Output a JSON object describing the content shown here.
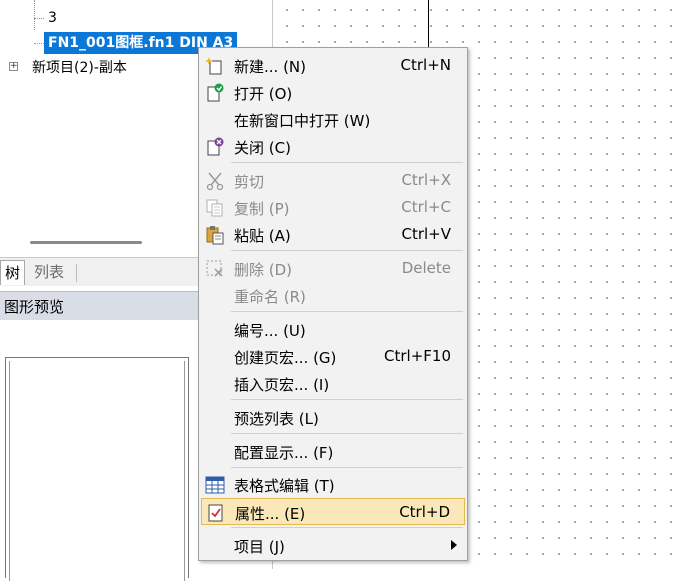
{
  "tree": {
    "items": [
      {
        "label": "3"
      },
      {
        "label": "FN1_001图框.fn1 DIN A3"
      },
      {
        "label": "新项目(2)-副本"
      }
    ],
    "expander_symbol": "+"
  },
  "tabs": [
    {
      "label": "树"
    },
    {
      "label": "列表"
    }
  ],
  "preview": {
    "title": "图形预览"
  },
  "colors": {
    "selection": "#0b78d7",
    "highlight": "#fbe8b8",
    "highlight_border": "#e5b850"
  },
  "context_menu": {
    "items": [
      {
        "label": "新建... (N)",
        "shortcut": "Ctrl+N",
        "icon": "new-sparkle-icon",
        "disabled": false
      },
      {
        "label": "打开 (O)",
        "shortcut": "",
        "icon": "open-page-icon",
        "disabled": false
      },
      {
        "label": "在新窗口中打开 (W)",
        "shortcut": "",
        "icon": "",
        "disabled": false
      },
      {
        "label": "关闭 (C)",
        "shortcut": "",
        "icon": "close-page-icon",
        "disabled": false
      },
      {
        "label": "剪切",
        "shortcut": "Ctrl+X",
        "icon": "scissors-icon",
        "disabled": true
      },
      {
        "label": "复制 (P)",
        "shortcut": "Ctrl+C",
        "icon": "copy-icon",
        "disabled": true
      },
      {
        "label": "粘贴 (A)",
        "shortcut": "Ctrl+V",
        "icon": "paste-clipboard-icon",
        "disabled": false
      },
      {
        "label": "删除 (D)",
        "shortcut": "Delete",
        "icon": "delete-icon",
        "disabled": true
      },
      {
        "label": "重命名 (R)",
        "shortcut": "",
        "icon": "",
        "disabled": true
      },
      {
        "label": "编号... (U)",
        "shortcut": "",
        "icon": "",
        "disabled": false
      },
      {
        "label": "创建页宏... (G)",
        "shortcut": "Ctrl+F10",
        "icon": "",
        "disabled": false
      },
      {
        "label": "插入页宏... (I)",
        "shortcut": "",
        "icon": "",
        "disabled": false
      },
      {
        "label": "预选列表 (L)",
        "shortcut": "",
        "icon": "",
        "disabled": false
      },
      {
        "label": "配置显示... (F)",
        "shortcut": "",
        "icon": "",
        "disabled": false
      },
      {
        "label": "表格式编辑 (T)",
        "shortcut": "",
        "icon": "table-grid-icon",
        "disabled": false
      },
      {
        "label": "属性... (E)",
        "shortcut": "Ctrl+D",
        "icon": "properties-check-icon",
        "disabled": false,
        "highlighted": true
      },
      {
        "label": "项目 (J)",
        "shortcut": "",
        "icon": "",
        "disabled": false,
        "submenu": true
      }
    ]
  }
}
